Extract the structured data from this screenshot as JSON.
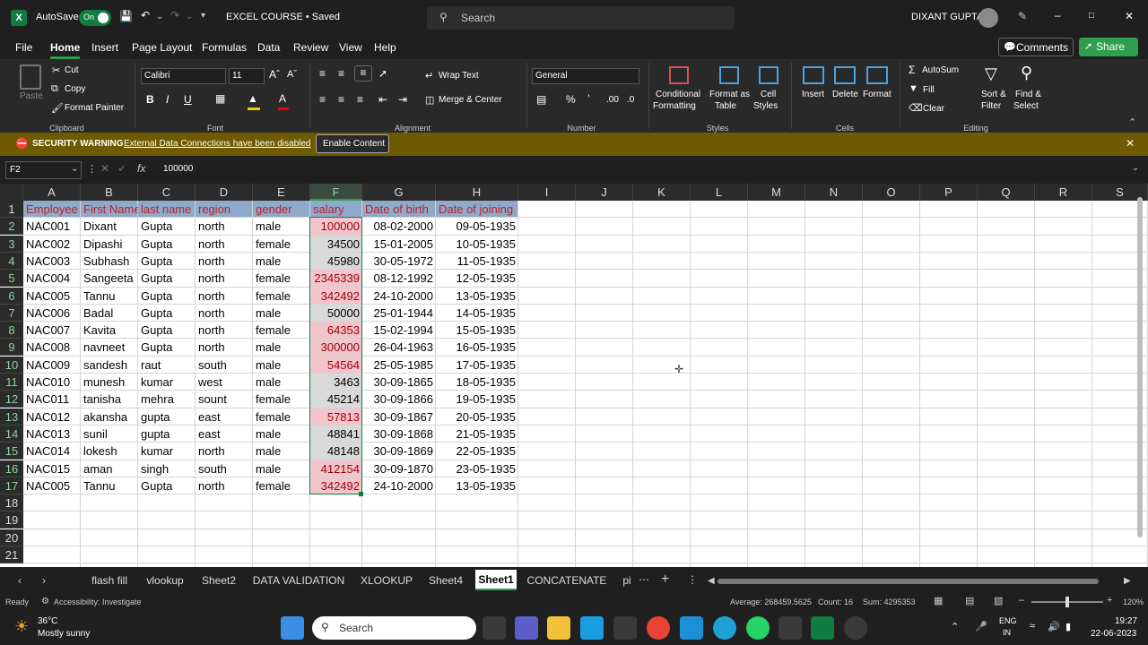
{
  "titlebar": {
    "autosave_label": "AutoSave",
    "autosave_state": "On",
    "doc_title": "EXCEL COURSE • Saved",
    "search_placeholder": "Search",
    "user_name": "DIXANT GUPTA"
  },
  "menu": {
    "items": [
      "File",
      "Home",
      "Insert",
      "Page Layout",
      "Formulas",
      "Data",
      "Review",
      "View",
      "Help"
    ],
    "active": "Home",
    "comments_label": "Comments",
    "share_label": "Share"
  },
  "ribbon": {
    "clipboard": {
      "paste": "Paste",
      "cut": "Cut",
      "copy": "Copy",
      "format_painter": "Format Painter",
      "group": "Clipboard"
    },
    "font": {
      "name": "Calibri",
      "size": "11",
      "group": "Font"
    },
    "alignment": {
      "wrap": "Wrap Text",
      "merge": "Merge & Center",
      "group": "Alignment"
    },
    "number": {
      "format": "General",
      "group": "Number"
    },
    "styles": {
      "conditional": "Conditional",
      "formatting": "Formatting",
      "format_as": "Format as",
      "table": "Table",
      "cell": "Cell",
      "cell_styles": "Styles",
      "group": "Styles"
    },
    "cells": {
      "insert": "Insert",
      "delete": "Delete",
      "format": "Format",
      "group": "Cells"
    },
    "editing": {
      "autosum": "AutoSum",
      "fill": "Fill",
      "clear": "Clear",
      "sort": "Sort &",
      "filter": "Filter",
      "find": "Find &",
      "select": "Select",
      "group": "Editing"
    }
  },
  "security": {
    "title": "SECURITY WARNING",
    "message": "External Data Connections have been disabled",
    "button": "Enable Content"
  },
  "formula_bar": {
    "name_box": "F2",
    "value": "100000"
  },
  "sheet": {
    "columns": [
      "A",
      "B",
      "C",
      "D",
      "E",
      "F",
      "G",
      "H",
      "I",
      "J",
      "K",
      "L",
      "M",
      "N",
      "O",
      "P",
      "Q",
      "R",
      "S"
    ],
    "rows": [
      "1",
      "2",
      "3",
      "4",
      "5",
      "6",
      "7",
      "8",
      "9",
      "10",
      "11",
      "12",
      "13",
      "14",
      "15",
      "16",
      "17",
      "18",
      "19",
      "20",
      "21"
    ],
    "headers": [
      "Employee",
      "First Name",
      "last name",
      "region",
      "gender",
      "salary",
      "Date of birth",
      "Date of joining"
    ],
    "data": [
      [
        "NAC001",
        "Dixant",
        "Gupta",
        "north",
        "male",
        "100000",
        "08-02-2000",
        "09-05-1935"
      ],
      [
        "NAC002",
        "Dipashi",
        "Gupta",
        "north",
        "female",
        "34500",
        "15-01-2005",
        "10-05-1935"
      ],
      [
        "NAC003",
        "Subhash",
        "Gupta",
        "north",
        "male",
        "45980",
        "30-05-1972",
        "11-05-1935"
      ],
      [
        "NAC004",
        "Sangeeta",
        "Gupta",
        "north",
        "female",
        "2345339",
        "08-12-1992",
        "12-05-1935"
      ],
      [
        "NAC005",
        "Tannu",
        "Gupta",
        "north",
        "female",
        "342492",
        "24-10-2000",
        "13-05-1935"
      ],
      [
        "NAC006",
        "Badal",
        "Gupta",
        "north",
        "male",
        "50000",
        "25-01-1944",
        "14-05-1935"
      ],
      [
        "NAC007",
        "Kavita",
        "Gupta",
        "north",
        "female",
        "64353",
        "15-02-1994",
        "15-05-1935"
      ],
      [
        "NAC008",
        "navneet",
        "Gupta",
        "north",
        "male",
        "300000",
        "26-04-1963",
        "16-05-1935"
      ],
      [
        "NAC009",
        "sandesh",
        "raut",
        "south",
        "male",
        "54564",
        "25-05-1985",
        "17-05-1935"
      ],
      [
        "NAC010",
        "munesh",
        "kumar",
        "west",
        "male",
        "3463",
        "30-09-1865",
        "18-05-1935"
      ],
      [
        "NAC011",
        "tanisha",
        "mehra",
        "sount",
        "female",
        "45214",
        "30-09-1866",
        "19-05-1935"
      ],
      [
        "NAC012",
        "akansha",
        "gupta",
        "east",
        "female",
        "57813",
        "30-09-1867",
        "20-05-1935"
      ],
      [
        "NAC013",
        "sunil",
        "gupta",
        "east",
        "male",
        "48841",
        "30-09-1868",
        "21-05-1935"
      ],
      [
        "NAC014",
        "lokesh",
        "kumar",
        "north",
        "male",
        "48148",
        "30-09-1869",
        "22-05-1935"
      ],
      [
        "NAC015",
        "aman",
        "singh",
        "south",
        "male",
        "412154",
        "30-09-1870",
        "23-05-1935"
      ],
      [
        "NAC005",
        "Tannu",
        "Gupta",
        "north",
        "female",
        "342492",
        "24-10-2000",
        "13-05-1935"
      ]
    ],
    "highlighted_rows": [
      1,
      4,
      5,
      7,
      8,
      9,
      12,
      15,
      16
    ],
    "highlight_color": "#f2c4cc",
    "header_fill": "#8ea9c9",
    "header_text_color": "#c0202a"
  },
  "tabs": {
    "items": [
      "flash fill",
      "vlookup",
      "Sheet2",
      "DATA VALIDATION",
      "XLOOKUP",
      "Sheet4",
      "Sheet1",
      "CONCATENATE",
      "pi"
    ],
    "active": "Sheet1"
  },
  "status": {
    "ready": "Ready",
    "accessibility": "Accessibility: Investigate",
    "average": "Average: 268459.5625",
    "count": "Count: 16",
    "sum": "Sum: 4295353",
    "zoom": "120%"
  },
  "taskbar": {
    "temp": "36°C",
    "weather": "Mostly sunny",
    "search": "Search",
    "lang1": "ENG",
    "lang2": "IN",
    "time": "19:27",
    "date": "22-06-2023"
  },
  "colors": {
    "accent_green": "#107c41",
    "share_green": "#2e9e4f"
  }
}
